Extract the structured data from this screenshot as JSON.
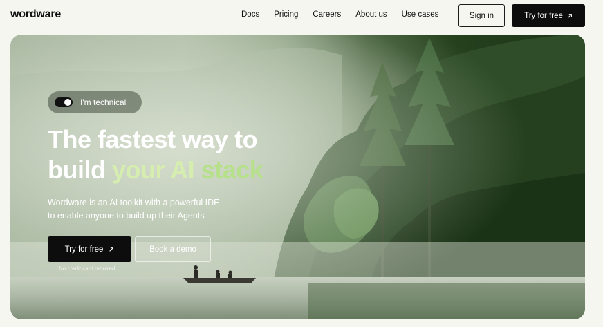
{
  "brand": {
    "logo_text": "wordware"
  },
  "nav": {
    "links": [
      {
        "label": "Docs"
      },
      {
        "label": "Pricing"
      },
      {
        "label": "Careers"
      },
      {
        "label": "About us"
      },
      {
        "label": "Use cases"
      }
    ],
    "signin_label": "Sign in",
    "try_label": "Try for free"
  },
  "hero": {
    "toggle_label": "I'm technical",
    "toggle_on": true,
    "headline_line1": "The fastest way to",
    "headline_line2_start": "build ",
    "headline_line2_accent": "your AI",
    "headline_line2_end": " stack",
    "subtext_line1": "Wordware is an AI toolkit with a powerful IDE",
    "subtext_line2": "to enable anyone to build up their Agents",
    "primary_cta": "Try for free",
    "secondary_cta": "Book a demo",
    "note": "No credit card required."
  },
  "colors": {
    "page_bg": "#f6f6f1",
    "button_dark": "#0d0d0d",
    "headline_accent": "#d6edb0"
  },
  "icons": {
    "arrow": "arrow-up-right-icon"
  }
}
